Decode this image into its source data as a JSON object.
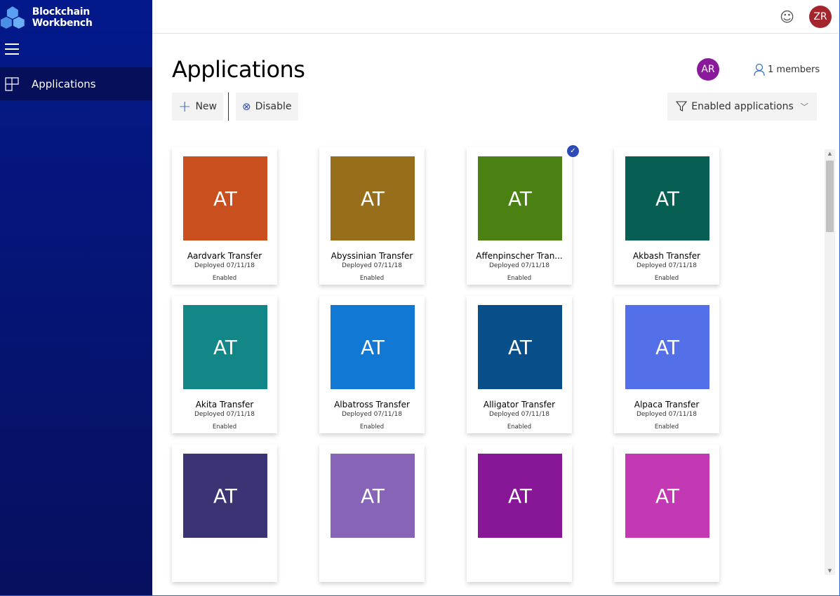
{
  "app": {
    "title": "Blockchain Workbench"
  },
  "sidebar": {
    "items": [
      {
        "label": "Applications"
      }
    ]
  },
  "header": {
    "user_initials": "ZR",
    "user_color": "#a4262c"
  },
  "page": {
    "title": "Applications",
    "owner_initials": "AR",
    "owner_color": "#8a1a9b",
    "members_label": "1 members"
  },
  "toolbar": {
    "new_label": "New",
    "disable_label": "Disable",
    "filter_label": "Enabled applications"
  },
  "applications": [
    {
      "initials": "AT",
      "name": "Aardvark Transfer",
      "deployed": "Deployed 07/11/18",
      "status": "Enabled",
      "color": "#c94f1e",
      "selected": false
    },
    {
      "initials": "AT",
      "name": "Abyssinian Transfer",
      "deployed": "Deployed 07/11/18",
      "status": "Enabled",
      "color": "#976f1a",
      "selected": false
    },
    {
      "initials": "AT",
      "name": "Affenpinscher Tran...",
      "deployed": "Deployed 07/11/18",
      "status": "Enabled",
      "color": "#4b8113",
      "selected": true
    },
    {
      "initials": "AT",
      "name": "Akbash Transfer",
      "deployed": "Deployed 07/11/18",
      "status": "Enabled",
      "color": "#075e52",
      "selected": false
    },
    {
      "initials": "AT",
      "name": "Akita Transfer",
      "deployed": "Deployed 07/11/18",
      "status": "Enabled",
      "color": "#138787",
      "selected": false
    },
    {
      "initials": "AT",
      "name": "Albatross Transfer",
      "deployed": "Deployed 07/11/18",
      "status": "Enabled",
      "color": "#1178d4",
      "selected": false
    },
    {
      "initials": "AT",
      "name": "Alligator Transfer",
      "deployed": "Deployed 07/11/18",
      "status": "Enabled",
      "color": "#084f8a",
      "selected": false
    },
    {
      "initials": "AT",
      "name": "Alpaca Transfer",
      "deployed": "Deployed 07/11/18",
      "status": "Enabled",
      "color": "#5470e8",
      "selected": false
    },
    {
      "initials": "AT",
      "color": "#3a3475"
    },
    {
      "initials": "AT",
      "color": "#8764b8"
    },
    {
      "initials": "AT",
      "color": "#881798"
    },
    {
      "initials": "AT",
      "color": "#c239b3"
    }
  ]
}
